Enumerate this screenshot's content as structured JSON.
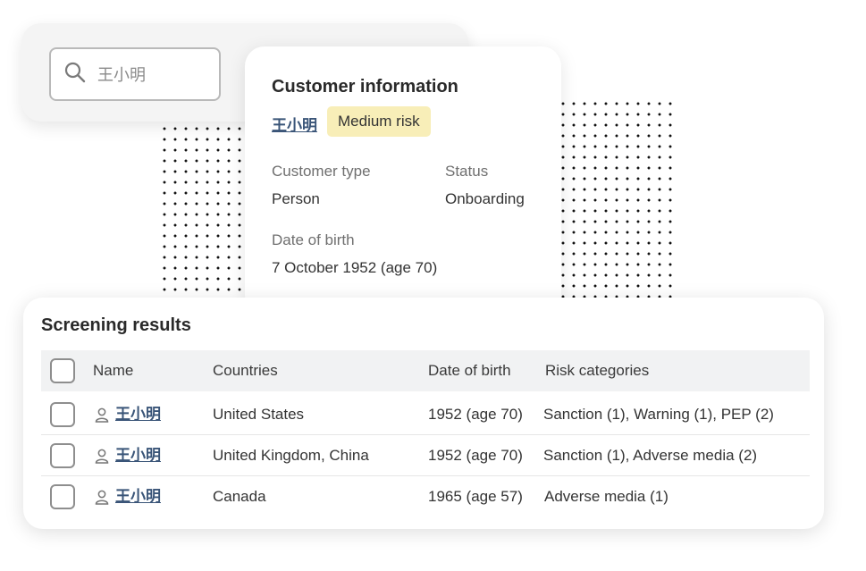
{
  "search": {
    "value": "王小明"
  },
  "customer_info": {
    "title": "Customer information",
    "name": "王小明",
    "risk_badge": "Medium risk",
    "customer_type_label": "Customer type",
    "customer_type_value": "Person",
    "status_label": "Status",
    "status_value": "Onboarding",
    "dob_label": "Date of birth",
    "dob_value": "7 October 1952 (age 70)"
  },
  "screening": {
    "title": "Screening results",
    "columns": [
      "Name",
      "Countries",
      "Date of birth",
      "Risk categories"
    ],
    "rows": [
      {
        "name": "王小明",
        "countries": "United States",
        "dob": "1952 (age 70)",
        "risk": "Sanction (1), Warning (1), PEP (2)"
      },
      {
        "name": "王小明",
        "countries": "United Kingdom, China",
        "dob": "1952 (age 70)",
        "risk": "Sanction (1), Adverse media (2)"
      },
      {
        "name": "王小明",
        "countries": "Canada",
        "dob": "1965 (age 57)",
        "risk": "Adverse media (1)"
      }
    ]
  },
  "colors": {
    "link": "#3a5578",
    "badge_bg": "#f8eeb8",
    "header_bg": "#f1f2f3"
  },
  "icons": {
    "search": "search-icon",
    "person": "person-icon"
  }
}
